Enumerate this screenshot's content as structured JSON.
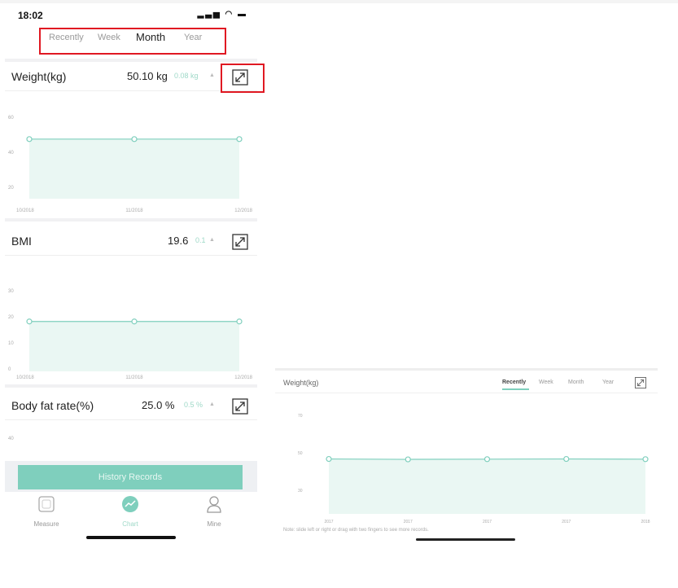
{
  "status_bar": {
    "time": "18:02",
    "icons": "▂▃▅ ◠ ▬"
  },
  "tabs": [
    {
      "label": "Recently",
      "active": false
    },
    {
      "label": "Week",
      "active": false
    },
    {
      "label": "Month",
      "active": true
    },
    {
      "label": "Year",
      "active": false
    }
  ],
  "metrics": {
    "weight": {
      "label": "Weight(kg)",
      "value": "50.10 kg",
      "delta": "0.08 kg"
    },
    "bmi": {
      "label": "BMI",
      "value": "19.6",
      "delta": "0.1"
    },
    "body_fat": {
      "label": "Body fat rate(%)",
      "value": "25.0 %",
      "delta": "0.5 %"
    }
  },
  "history_button": "History Records",
  "bottom_nav": [
    {
      "label": "Measure",
      "icon": "measure-icon",
      "active": false
    },
    {
      "label": "Chart",
      "icon": "chart-icon",
      "active": true
    },
    {
      "label": "Mine",
      "icon": "person-icon",
      "active": false
    }
  ],
  "landscape": {
    "title": "Weight(kg)",
    "tabs": [
      {
        "label": "Recently",
        "active": true
      },
      {
        "label": "Week",
        "active": false
      },
      {
        "label": "Month",
        "active": false
      },
      {
        "label": "Year",
        "active": false
      }
    ],
    "note": "Note: slide left or right or drag with two fingers to see more records."
  },
  "colors": {
    "accent": "#7fcfbd",
    "fill": "#eaf7f3",
    "highlight_box": "#e01822"
  },
  "chart_data": [
    {
      "type": "area",
      "title": "Weight(kg)",
      "categories": [
        "10/2018",
        "11/2018",
        "12/2018"
      ],
      "series": [
        {
          "values": [
            50.1,
            50.1,
            50.1
          ]
        }
      ],
      "yticks": [
        "60",
        "40",
        "20"
      ],
      "ylim": [
        15,
        62
      ]
    },
    {
      "type": "area",
      "title": "BMI",
      "categories": [
        "10/2018",
        "11/2018",
        "12/2018"
      ],
      "series": [
        {
          "values": [
            19.6,
            19.6,
            19.6
          ]
        }
      ],
      "yticks": [
        "30",
        "20",
        "10",
        "0"
      ],
      "ylim": [
        0,
        32
      ]
    },
    {
      "type": "area",
      "title": "Body fat rate(%)",
      "categories": [],
      "series": [],
      "yticks": [
        "40"
      ],
      "ylim": [
        0,
        45
      ]
    },
    {
      "type": "area",
      "title": "Weight(kg)",
      "categories": [
        "2017",
        "2017",
        "2017",
        "2017",
        "2018"
      ],
      "series": [
        {
          "values": [
            50.1,
            49.9,
            50.0,
            50.1,
            50.0
          ]
        }
      ],
      "yticks": [
        "70",
        "50",
        "30"
      ],
      "ylim": [
        22,
        72
      ]
    }
  ]
}
